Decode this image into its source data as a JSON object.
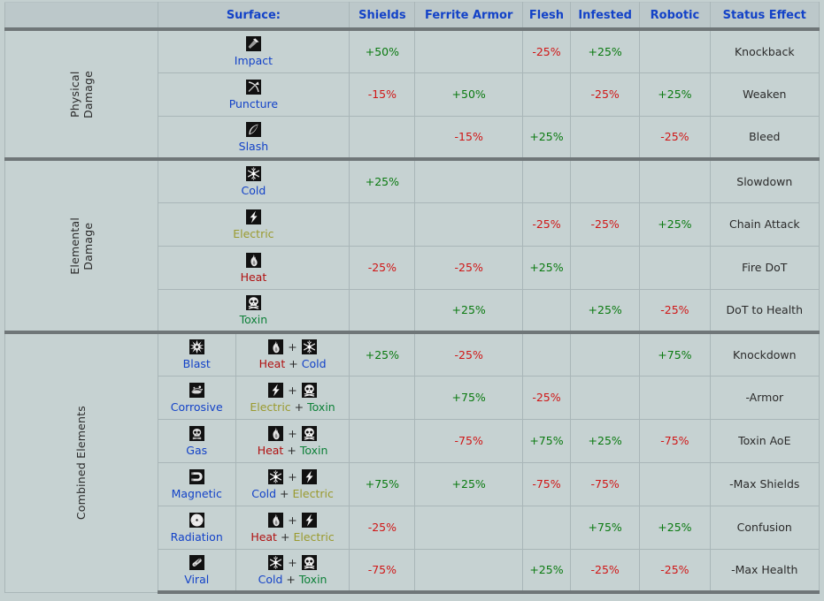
{
  "table": {
    "headers": {
      "group": "",
      "surface": "Surface:",
      "shields": "Shields",
      "ferrite_armor": "Ferrite Armor",
      "flesh": "Flesh",
      "infested": "Infested",
      "robotic": "Robotic",
      "status_effect": "Status Effect"
    },
    "plus": "+",
    "sections": [
      {
        "group_label": "Physical\nDamage",
        "rows": [
          {
            "name": "Impact",
            "icon": "hammer-icon",
            "name_color_class": "c-impact",
            "shields": "+50%",
            "ferrite_armor": "",
            "flesh": "-25%",
            "infested": "+25%",
            "robotic": "",
            "status_effect": "Knockback"
          },
          {
            "name": "Puncture",
            "icon": "arrow-icon",
            "name_color_class": "c-puncture",
            "shields": "-15%",
            "ferrite_armor": "+50%",
            "flesh": "",
            "infested": "-25%",
            "robotic": "+25%",
            "status_effect": "Weaken"
          },
          {
            "name": "Slash",
            "icon": "blade-icon",
            "name_color_class": "c-slash",
            "shields": "",
            "ferrite_armor": "-15%",
            "flesh": "+25%",
            "infested": "",
            "robotic": "-25%",
            "status_effect": "Bleed"
          }
        ]
      },
      {
        "group_label": "Elemental\nDamage",
        "rows": [
          {
            "name": "Cold",
            "icon": "snowflake-icon",
            "name_color_class": "c-cold",
            "shields": "+25%",
            "ferrite_armor": "",
            "flesh": "",
            "infested": "",
            "robotic": "",
            "status_effect": "Slowdown"
          },
          {
            "name": "Electric",
            "icon": "lightning-icon",
            "name_color_class": "c-electric",
            "shields": "",
            "ferrite_armor": "",
            "flesh": "-25%",
            "infested": "-25%",
            "robotic": "+25%",
            "status_effect": "Chain Attack"
          },
          {
            "name": "Heat",
            "icon": "flame-icon",
            "name_color_class": "c-heat",
            "shields": "-25%",
            "ferrite_armor": "-25%",
            "flesh": "+25%",
            "infested": "",
            "robotic": "",
            "status_effect": "Fire DoT"
          },
          {
            "name": "Toxin",
            "icon": "skull-icon",
            "name_color_class": "c-toxin",
            "shields": "",
            "ferrite_armor": "+25%",
            "flesh": "",
            "infested": "+25%",
            "robotic": "-25%",
            "status_effect": "DoT to Health"
          }
        ]
      },
      {
        "group_label": "Combined Elements",
        "rows": [
          {
            "name": "Blast",
            "icon": "starburst-icon",
            "name_color_class": "c-blast",
            "combo": [
              {
                "name": "Heat",
                "icon": "flame-icon",
                "color_class": "c-heat"
              },
              {
                "name": "Cold",
                "icon": "snowflake-icon",
                "color_class": "c-cold"
              }
            ],
            "shields": "+25%",
            "ferrite_armor": "-25%",
            "flesh": "",
            "infested": "",
            "robotic": "+75%",
            "status_effect": "Knockdown"
          },
          {
            "name": "Corrosive",
            "icon": "acid-splash-icon",
            "name_color_class": "c-corrosive",
            "combo": [
              {
                "name": "Electric",
                "icon": "lightning-icon",
                "color_class": "c-electric"
              },
              {
                "name": "Toxin",
                "icon": "skull-icon",
                "color_class": "c-toxin"
              }
            ],
            "shields": "",
            "ferrite_armor": "+75%",
            "flesh": "-25%",
            "infested": "",
            "robotic": "",
            "status_effect": "-Armor"
          },
          {
            "name": "Gas",
            "icon": "gas-skull-icon",
            "name_color_class": "c-gas",
            "combo": [
              {
                "name": "Heat",
                "icon": "flame-icon",
                "color_class": "c-heat"
              },
              {
                "name": "Toxin",
                "icon": "skull-icon",
                "color_class": "c-toxin"
              }
            ],
            "shields": "",
            "ferrite_armor": "-75%",
            "flesh": "+75%",
            "infested": "+25%",
            "robotic": "-75%",
            "status_effect": "Toxin AoE"
          },
          {
            "name": "Magnetic",
            "icon": "magnet-icon",
            "name_color_class": "c-magnetic",
            "combo": [
              {
                "name": "Cold",
                "icon": "snowflake-icon",
                "color_class": "c-cold"
              },
              {
                "name": "Electric",
                "icon": "lightning-icon",
                "color_class": "c-electric"
              }
            ],
            "shields": "+75%",
            "ferrite_armor": "+25%",
            "flesh": "-75%",
            "infested": "-75%",
            "robotic": "",
            "status_effect": "-Max Shields"
          },
          {
            "name": "Radiation",
            "icon": "radiation-icon",
            "name_color_class": "c-radiation",
            "combo": [
              {
                "name": "Heat",
                "icon": "flame-icon",
                "color_class": "c-heat"
              },
              {
                "name": "Electric",
                "icon": "lightning-icon",
                "color_class": "c-electric"
              }
            ],
            "shields": "-25%",
            "ferrite_armor": "",
            "flesh": "",
            "infested": "+75%",
            "robotic": "+25%",
            "status_effect": "Confusion"
          },
          {
            "name": "Viral",
            "icon": "vial-icon",
            "name_color_class": "c-viral",
            "combo": [
              {
                "name": "Cold",
                "icon": "snowflake-icon",
                "color_class": "c-cold"
              },
              {
                "name": "Toxin",
                "icon": "skull-icon",
                "color_class": "c-toxin"
              }
            ],
            "shields": "-75%",
            "ferrite_armor": "",
            "flesh": "+25%",
            "infested": "-25%",
            "robotic": "-25%",
            "status_effect": "-Max Health"
          }
        ]
      }
    ]
  },
  "colors": {
    "positive": "#0a7a10",
    "negative": "#d01616",
    "header_text": "#1342c8",
    "background": "#c4d0d0",
    "header_bg": "#bcc8ca",
    "separator": "#6f7678"
  }
}
